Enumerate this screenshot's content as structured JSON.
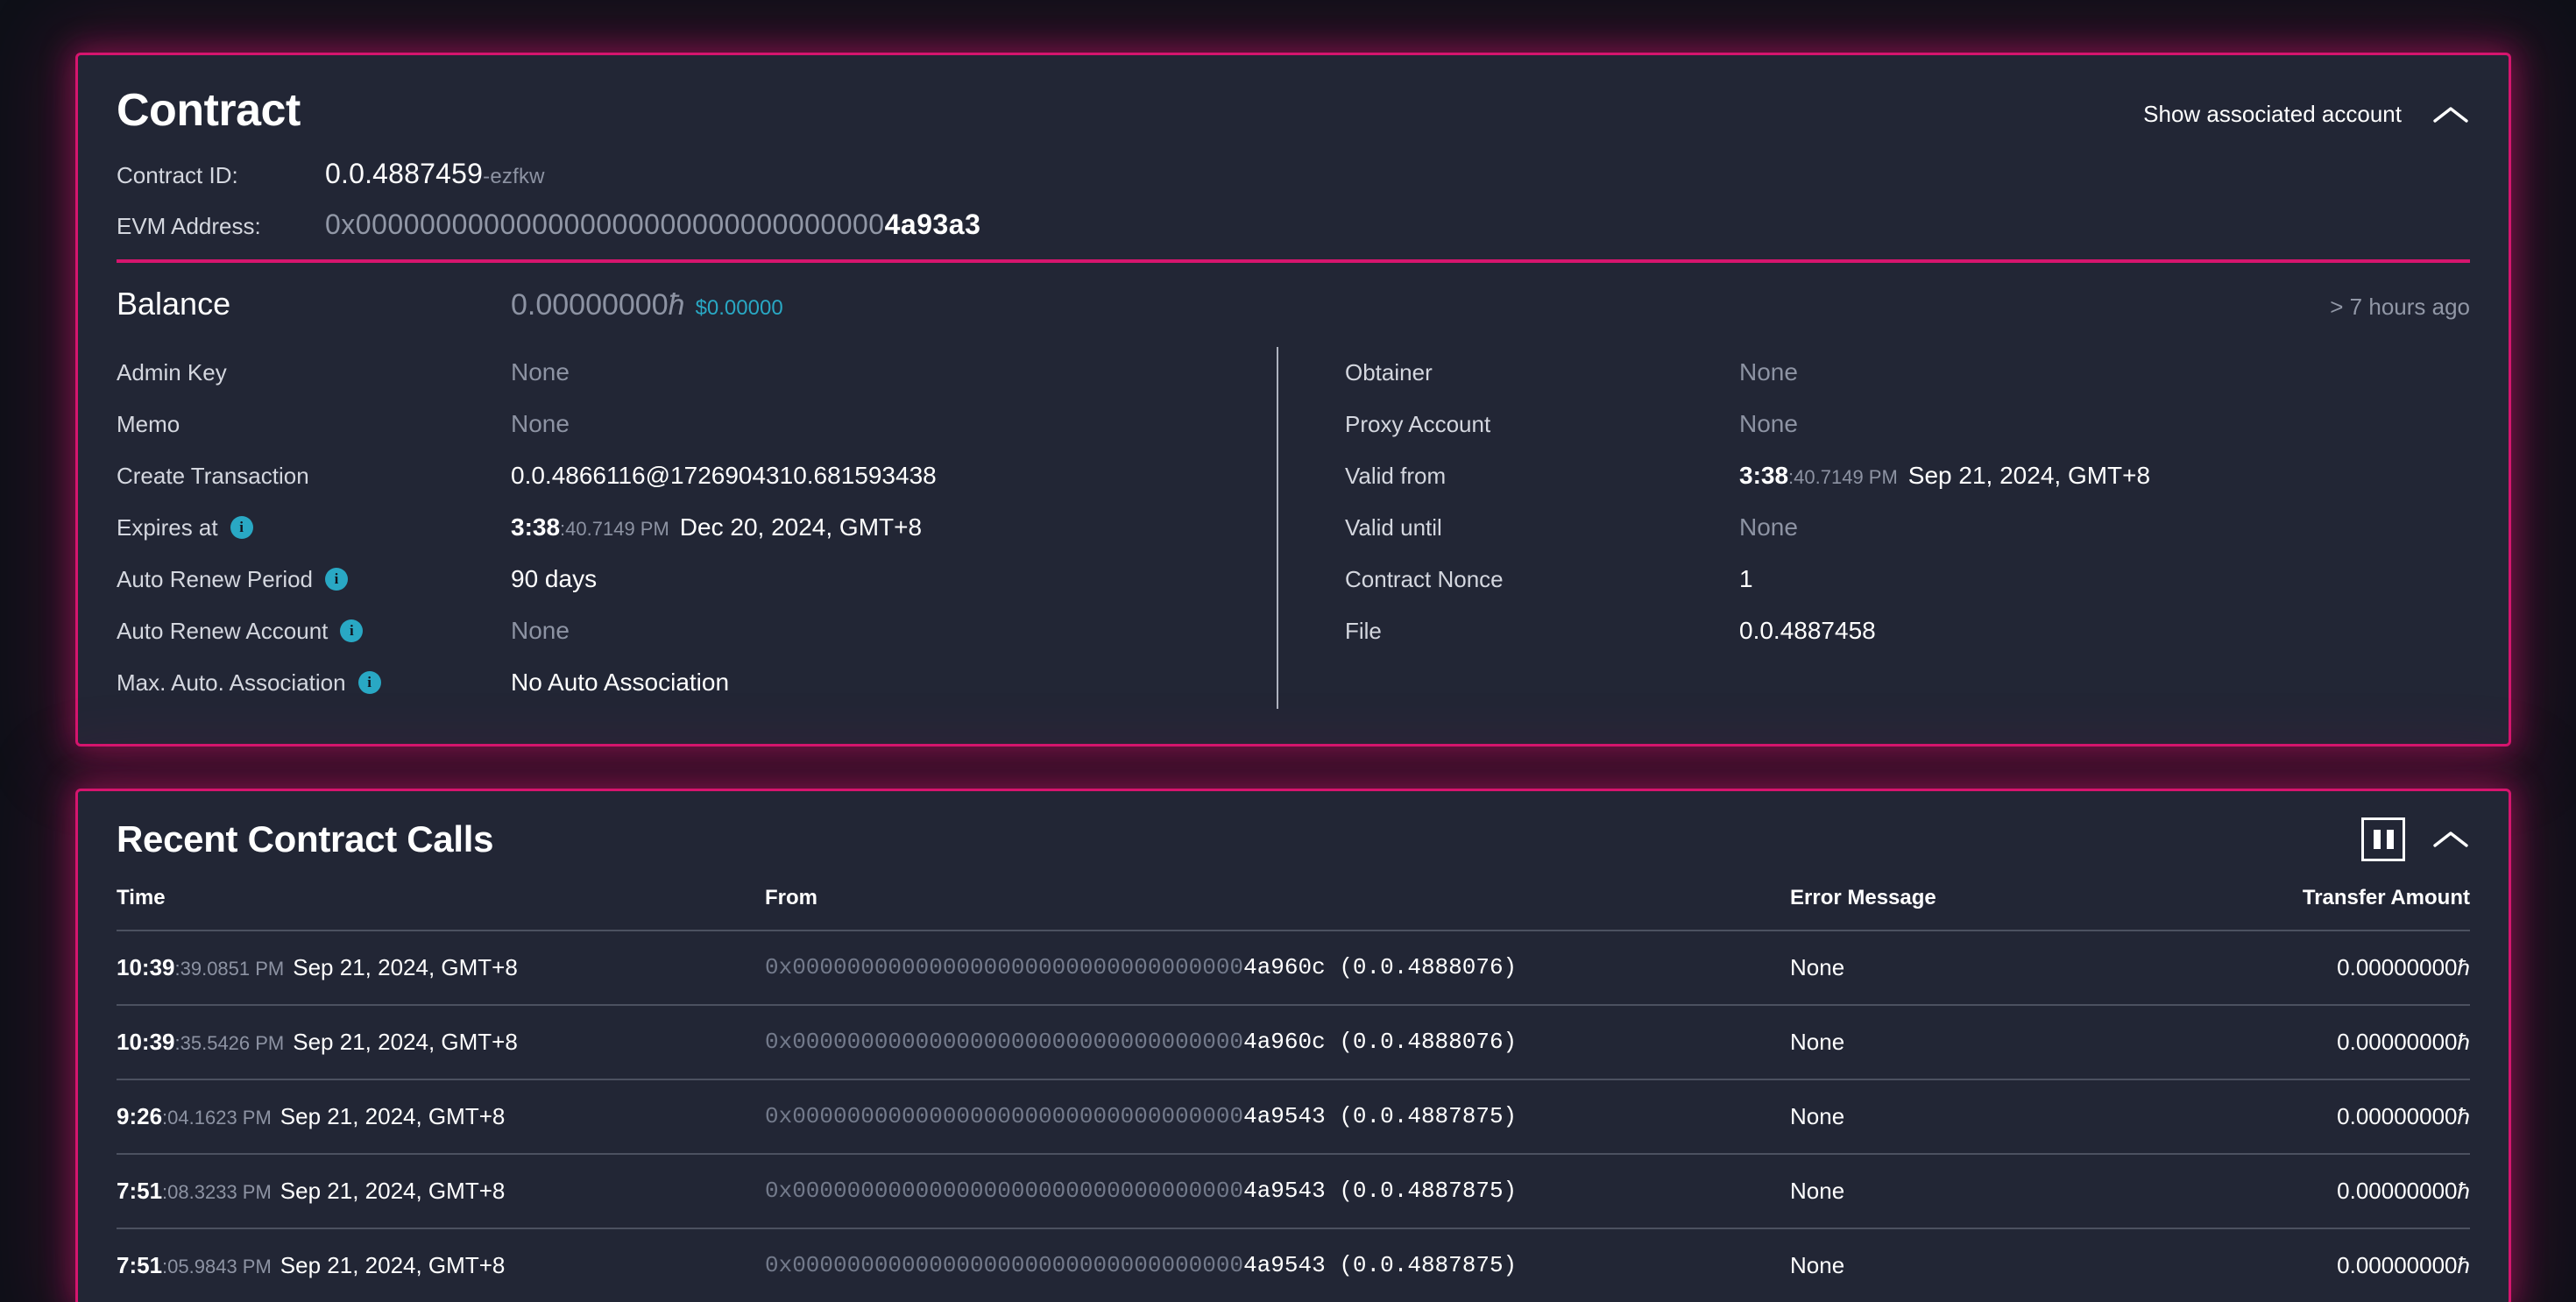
{
  "contract_card": {
    "title": "Contract",
    "show_associated_label": "Show associated account",
    "collapse_icon": "chevron-up-icon",
    "contract_id_label": "Contract ID:",
    "contract_id_value": "0.0.4887459",
    "contract_id_checksum": "-ezfkw",
    "evm_label": "EVM Address:",
    "evm_zeros": "0x000000000000000000000000000000000",
    "evm_tail": "4a93a3",
    "balance_label": "Balance",
    "balance_value": "0.00000000",
    "balance_symbol": "ħ",
    "balance_usd": "$0.00000",
    "balance_updated": "> 7 hours ago",
    "left_rows": [
      {
        "label": "Admin Key",
        "value": "None",
        "muted": true,
        "info": false
      },
      {
        "label": "Memo",
        "value": "None",
        "muted": true,
        "info": false
      },
      {
        "label": "Create Transaction",
        "value": "0.0.4866116@1726904310.681593438",
        "muted": false,
        "info": false
      },
      {
        "label": "Expires at",
        "info": true,
        "ts": {
          "big": "3:38",
          "frac": ":40.7149 PM",
          "date": "Dec 20, 2024, GMT+8"
        }
      },
      {
        "label": "Auto Renew Period",
        "value": "90 days",
        "muted": false,
        "info": true
      },
      {
        "label": "Auto Renew Account",
        "value": "None",
        "muted": true,
        "info": true
      },
      {
        "label": "Max. Auto. Association",
        "value": "No Auto Association",
        "muted": false,
        "info": true
      }
    ],
    "right_rows": [
      {
        "label": "Obtainer",
        "value": "None",
        "muted": true,
        "info": false
      },
      {
        "label": "Proxy Account",
        "value": "None",
        "muted": true,
        "info": false
      },
      {
        "label": "Valid from",
        "info": false,
        "ts": {
          "big": "3:38",
          "frac": ":40.7149 PM",
          "date": "Sep 21, 2024, GMT+8"
        }
      },
      {
        "label": "Valid until",
        "value": "None",
        "muted": true,
        "info": false
      },
      {
        "label": "Contract Nonce",
        "value": "1",
        "muted": false,
        "info": false
      },
      {
        "label": "File",
        "value": "0.0.4887458",
        "muted": false,
        "info": false
      }
    ]
  },
  "calls_card": {
    "title": "Recent Contract Calls",
    "pause_icon": "pause-icon",
    "collapse_icon": "chevron-up-icon",
    "columns": [
      "Time",
      "From",
      "Error Message",
      "Transfer Amount"
    ],
    "rows": [
      {
        "time_big": "10:39",
        "time_frac": ":39.0851 PM",
        "time_date": "Sep 21, 2024, GMT+8",
        "from_zeros": "0x000000000000000000000000000000000",
        "from_tail": "4a960c",
        "from_account": "(0.0.4888076)",
        "error": "None",
        "amount": "0.00000000",
        "amount_symbol": "ħ"
      },
      {
        "time_big": "10:39",
        "time_frac": ":35.5426 PM",
        "time_date": "Sep 21, 2024, GMT+8",
        "from_zeros": "0x000000000000000000000000000000000",
        "from_tail": "4a960c",
        "from_account": "(0.0.4888076)",
        "error": "None",
        "amount": "0.00000000",
        "amount_symbol": "ħ"
      },
      {
        "time_big": "9:26",
        "time_frac": ":04.1623 PM",
        "time_date": "Sep 21, 2024, GMT+8",
        "from_zeros": "0x000000000000000000000000000000000",
        "from_tail": "4a9543",
        "from_account": "(0.0.4887875)",
        "error": "None",
        "amount": "0.00000000",
        "amount_symbol": "ħ"
      },
      {
        "time_big": "7:51",
        "time_frac": ":08.3233 PM",
        "time_date": "Sep 21, 2024, GMT+8",
        "from_zeros": "0x000000000000000000000000000000000",
        "from_tail": "4a9543",
        "from_account": "(0.0.4887875)",
        "error": "None",
        "amount": "0.00000000",
        "amount_symbol": "ħ"
      },
      {
        "time_big": "7:51",
        "time_frac": ":05.9843 PM",
        "time_date": "Sep 21, 2024, GMT+8",
        "from_zeros": "0x000000000000000000000000000000000",
        "from_tail": "4a9543",
        "from_account": "(0.0.4887875)",
        "error": "None",
        "amount": "0.00000000",
        "amount_symbol": "ħ"
      }
    ]
  },
  "colors": {
    "accent_pink": "#d6156e",
    "card_bg": "#222635",
    "page_bg": "#0e1018",
    "info_cyan": "#29a8c4",
    "muted_text": "#8d93a3"
  }
}
